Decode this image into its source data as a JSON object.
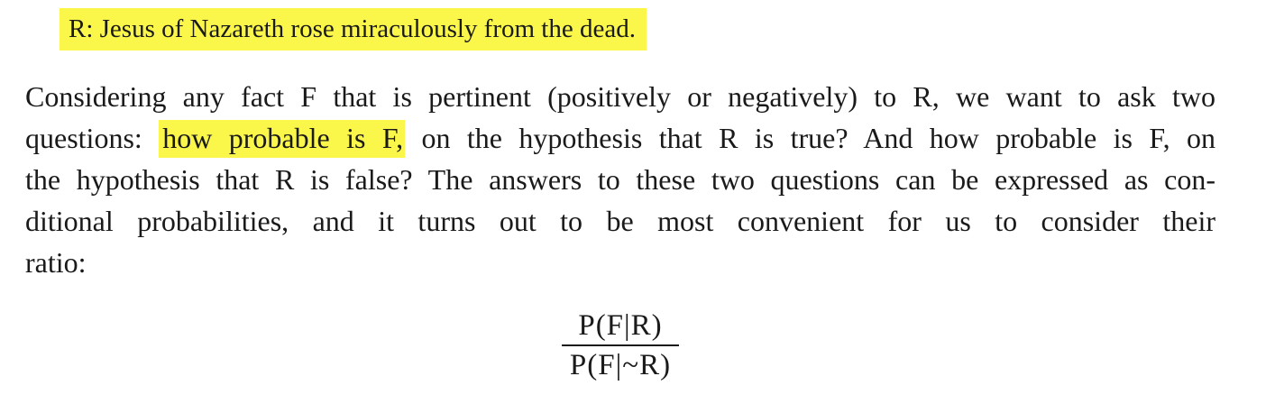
{
  "statement": "R: Jesus of Nazareth rose miraculously from the dead.",
  "paragraph": {
    "line1": "Considering any fact F that is pertinent (positively or negatively) to R, we want to ask two",
    "line2_before": "questions: ",
    "line2_highlight": "how probable is F,",
    "line2_after": " on the hypothesis that R is true? And how probable is F, on",
    "line3": "the hypothesis that R is false? The answers to these two questions can be expressed as con-",
    "line4": "ditional probabilities, and it turns out to be most convenient for us to consider their",
    "line5": "ratio:"
  },
  "formula": {
    "numerator": "P(F|R)",
    "denominator": "P(F|~R)"
  },
  "colors": {
    "highlight": "#fbf74a",
    "text": "#1a1a1a"
  }
}
